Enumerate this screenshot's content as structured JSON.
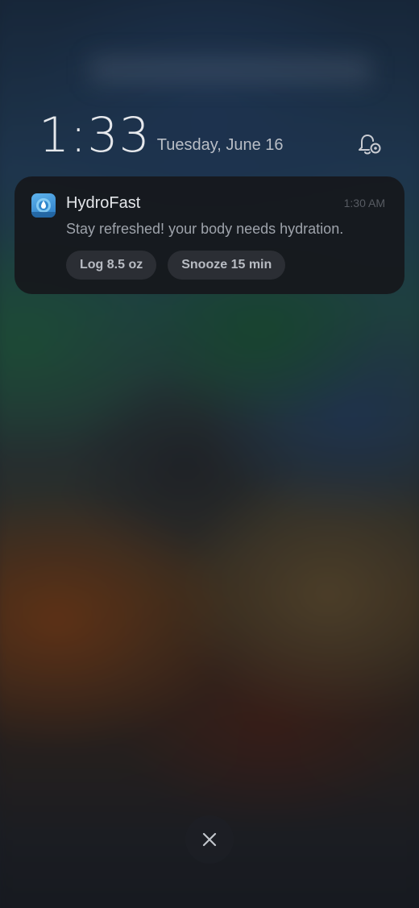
{
  "lockscreen": {
    "time": "1:33",
    "date": "Tuesday, June 16"
  },
  "notification": {
    "app_name": "HydroFast",
    "time": "1:30 AM",
    "message": "Stay refreshed! your body needs hydration.",
    "actions": [
      {
        "label": "Log 8.5 oz"
      },
      {
        "label": "Snooze 15 min"
      }
    ]
  },
  "icons": {
    "settings": "notification-settings-icon",
    "app": "hydrofast-app-icon",
    "dismiss": "close-icon"
  },
  "colors": {
    "notification_bg": "#16181c",
    "action_bg": "#2b2e34",
    "app_icon": "#3a8fd8"
  }
}
